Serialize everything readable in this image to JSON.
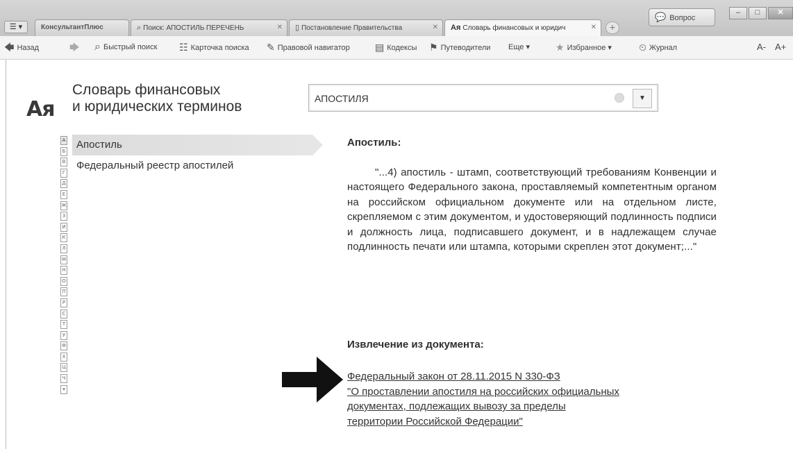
{
  "window": {
    "menu_button": "☰ ▾",
    "question_button": "Вопрос",
    "controls": {
      "minimize": "–",
      "maximize": "□",
      "close": "✕"
    }
  },
  "tabs": [
    {
      "label": "КонсультантПлюс",
      "icon": "brand",
      "active": false
    },
    {
      "label": "Поиск: АПОСТИЛЬ ПЕРЕЧЕНЬ",
      "icon": "search-icon",
      "active": false
    },
    {
      "label": "Постановление Правительства",
      "icon": "document-icon",
      "active": false
    },
    {
      "label": "Словарь финансовых и юридич",
      "icon": "dictionary-icon",
      "active": true
    }
  ],
  "new_tab": "+",
  "toolbar": {
    "back": "Назад",
    "quick_search": "Быстрый поиск",
    "search_card": "Карточка поиска",
    "legal_navigator": "Правовой навигатор",
    "codes": "Кодексы",
    "guides": "Путеводители",
    "more": "Еще ▾",
    "favorites": "Избранное ▾",
    "history": "Журнал",
    "font_smaller": "A-",
    "font_larger": "A+"
  },
  "dictionary": {
    "logo": "Ая",
    "title_line1": "Словарь финансовых",
    "title_line2": "и юридических терминов"
  },
  "search": {
    "value": "АПОСТИЛЯ",
    "dropdown": "▼"
  },
  "alphabet": [
    "А",
    "Б",
    "В",
    "Г",
    "Д",
    "Е",
    "Ж",
    "З",
    "И",
    "К",
    "Л",
    "М",
    "Н",
    "О",
    "П",
    "Р",
    "С",
    "Т",
    "У",
    "Ф",
    "Х",
    "Ц",
    "Ч"
  ],
  "terms": [
    {
      "label": "Апостиль",
      "selected": true
    },
    {
      "label": "Федеральный реестр апостилей",
      "selected": false
    }
  ],
  "article": {
    "heading": "Апостиль:",
    "body": "\"...4) апостиль - штамп, соответствующий требованиям Конвенции и настоящего Федерального закона, проставляемый компетентным органом на российском официальном документе или на отдельном листе, скрепляемом с этим документом, и удостоверяющий подлинность подписи и должность лица, подписавшего документ, и в надлежащем случае подлинность печати или штампа, которыми скреплен этот документ;...\"",
    "extract_heading": "Извлечение из документа:",
    "link_line1": "Федеральный закон от 28.11.2015 N 330-ФЗ",
    "link_line2": "\"О проставлении апостиля на российских официальных",
    "link_line3": "документах, подлежащих вывозу за пределы",
    "link_line4": "территории Российской Федерации\""
  },
  "colors": {
    "tabbar": "#c8c8c8",
    "toolbar": "#f4f4f4",
    "selected_term": "#dcdcdc",
    "arrow": "#111111"
  }
}
